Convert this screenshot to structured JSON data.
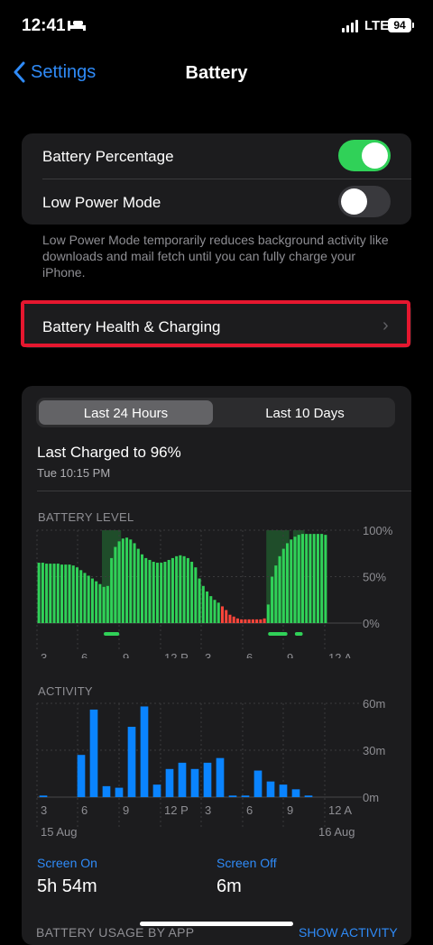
{
  "status": {
    "time": "12:41",
    "network": "LTE",
    "battery": "94"
  },
  "nav": {
    "back_label": "Settings",
    "title": "Battery"
  },
  "settings": {
    "battery_percentage": {
      "label": "Battery Percentage",
      "on": true
    },
    "low_power_mode": {
      "label": "Low Power Mode",
      "on": false
    },
    "note": "Low Power Mode temporarily reduces background activity like downloads and mail fetch until you can fully charge your iPhone.",
    "health_label": "Battery Health & Charging"
  },
  "usage": {
    "tabs": [
      {
        "label": "Last 24 Hours",
        "selected": true
      },
      {
        "label": "Last 10 Days",
        "selected": false
      }
    ],
    "last_charged": "Last Charged to 96%",
    "last_charged_time": "Tue 10:15 PM",
    "screen_on_label": "Screen On",
    "screen_on_value": "5h 54m",
    "screen_off_label": "Screen Off",
    "screen_off_value": "6m",
    "section_label": "BATTERY USAGE BY APP",
    "show_activity": "SHOW ACTIVITY"
  },
  "colors": {
    "accent": "#2f8bf8",
    "green": "#30d158",
    "red": "#ff453a",
    "bar_blue": "#0a84ff",
    "highlight": "#e5172f"
  },
  "chart_data": [
    {
      "type": "bar",
      "title": "BATTERY LEVEL",
      "x_tick_labels": [
        "3",
        "6",
        "9",
        "12 P",
        "3",
        "6",
        "9",
        "12 A"
      ],
      "y_tick_labels": [
        "100%",
        "50%",
        "0%"
      ],
      "ylim": [
        0,
        100
      ],
      "values": [
        65,
        65,
        64,
        64,
        64,
        64,
        63,
        63,
        63,
        62,
        60,
        57,
        54,
        51,
        48,
        45,
        42,
        39,
        40,
        70,
        82,
        88,
        91,
        92,
        90,
        86,
        80,
        74,
        70,
        68,
        66,
        65,
        65,
        66,
        68,
        70,
        72,
        73,
        72,
        70,
        66,
        60,
        48,
        40,
        34,
        29,
        25,
        22,
        18,
        14,
        9,
        7,
        5,
        4,
        4,
        4,
        4,
        4,
        4,
        5,
        20,
        50,
        62,
        72,
        80,
        86,
        90,
        93,
        95,
        96,
        96,
        96,
        96,
        96,
        96,
        95
      ],
      "low_battery_below": 20,
      "charging_bar_ranges": [
        [
          17,
          21
        ],
        [
          60,
          65
        ],
        [
          67,
          69
        ]
      ],
      "charging_marker_ranges": [
        [
          17,
          21
        ],
        [
          60,
          65
        ],
        [
          67,
          69
        ]
      ]
    },
    {
      "type": "bar",
      "title": "ACTIVITY",
      "x_tick_labels": [
        "3",
        "6",
        "9",
        "12 P",
        "3",
        "6",
        "9",
        "12 A"
      ],
      "date_labels": [
        "15 Aug",
        "16 Aug"
      ],
      "y_tick_labels": [
        "60m",
        "30m",
        "0m"
      ],
      "ylim": [
        0,
        60
      ],
      "values": [
        1,
        0,
        0,
        27,
        56,
        7,
        6,
        45,
        58,
        8,
        18,
        22,
        18,
        22,
        25,
        1,
        1,
        17,
        10,
        8,
        5,
        1,
        0
      ]
    }
  ]
}
